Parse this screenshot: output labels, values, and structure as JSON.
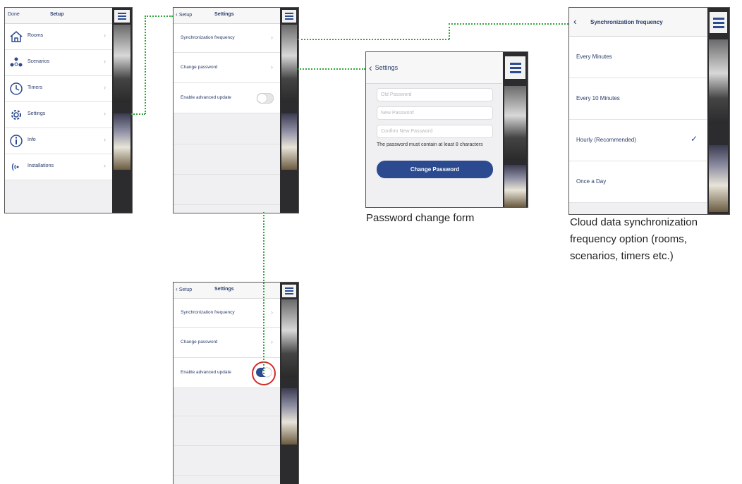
{
  "colors": {
    "accent": "#2b4a8f",
    "connector": "#2fa83a",
    "sidebar": "#2c2c2e",
    "highlight": "#d42a2a"
  },
  "setup_screen": {
    "done_label": "Done",
    "title": "Setup",
    "items": [
      {
        "label": "Rooms",
        "icon": "house-icon"
      },
      {
        "label": "Scenarios",
        "icon": "scenarios-icon"
      },
      {
        "label": "Timers",
        "icon": "timer-icon"
      },
      {
        "label": "Settings",
        "icon": "gear-icon"
      },
      {
        "label": "Info",
        "icon": "info-icon"
      },
      {
        "label": "Installations",
        "icon": "wireless-icon"
      }
    ]
  },
  "settings_screen": {
    "back_label": "Setup",
    "title": "Settings",
    "sync_label": "Synchronization frequency",
    "password_label": "Change password",
    "advanced_label": "Enable advanced update",
    "advanced_enabled": false
  },
  "settings_screen_enabled": {
    "back_label": "Setup",
    "title": "Settings",
    "sync_label": "Synchronization frequency",
    "password_label": "Change password",
    "advanced_label": "Enable advanced update",
    "advanced_enabled": true
  },
  "password_screen": {
    "back_label": "Settings",
    "old_placeholder": "Old Password",
    "new_placeholder": "New Password",
    "confirm_placeholder": "Confirm New Password",
    "hint": "The password must contain at least 8 characters",
    "button_label": "Change Password"
  },
  "sync_screen": {
    "title": "Synchronization frequency",
    "options": [
      {
        "label": "Every Minutes",
        "selected": false
      },
      {
        "label": "Every 10 Minutes",
        "selected": false
      },
      {
        "label": "Hourly (Recommended)",
        "selected": true
      },
      {
        "label": "Once a Day",
        "selected": false
      }
    ],
    "check": "✓"
  },
  "captions": {
    "password": "Password change form",
    "sync_1": "Cloud data synchronization",
    "sync_2": "frequency option (rooms,",
    "sync_3": "scenarios,  timers etc.)"
  }
}
